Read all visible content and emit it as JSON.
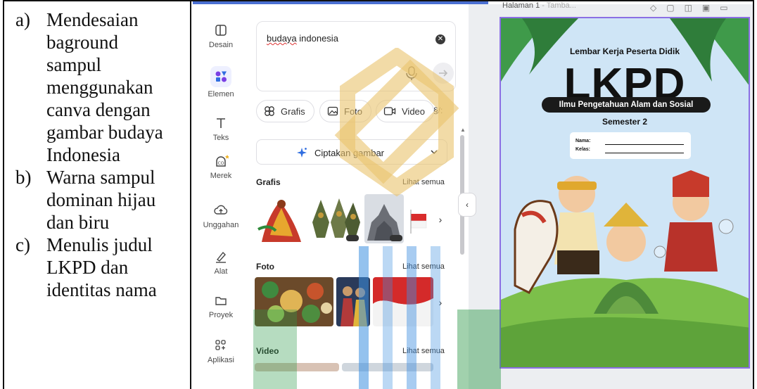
{
  "left_column": {
    "items": [
      {
        "marker": "a)",
        "lines": [
          "Mendesaian",
          "baground",
          "sampul",
          "menggunakan",
          "canva dengan",
          "gambar budaya",
          "Indonesia"
        ]
      },
      {
        "marker": "b)",
        "lines": [
          "Warna sampul",
          "dominan hijau",
          "dan biru"
        ]
      },
      {
        "marker": "c)",
        "lines": [
          "Menulis judul",
          "LKPD dan",
          "identitas nama"
        ]
      }
    ]
  },
  "rail": {
    "items": [
      {
        "label": "Desain",
        "icon": "layout-icon"
      },
      {
        "label": "Elemen",
        "icon": "elements-icon"
      },
      {
        "label": "Teks",
        "icon": "text-icon"
      },
      {
        "label": "Merek",
        "icon": "brand-icon"
      },
      {
        "label": "Unggahan",
        "icon": "upload-cloud-icon"
      },
      {
        "label": "Alat",
        "icon": "pen-tool-icon"
      },
      {
        "label": "Proyek",
        "icon": "folder-icon"
      },
      {
        "label": "Aplikasi",
        "icon": "apps-icon"
      }
    ]
  },
  "panel": {
    "search_value": "budaya indonesia",
    "search_first_word": "budaya",
    "search_rest": " indonesia",
    "chips": [
      "Grafis",
      "Foto",
      "Video",
      "§/:"
    ],
    "create_label": "Ciptakan gambar",
    "sections": [
      {
        "title": "Grafis",
        "link": "Lihat semua"
      },
      {
        "title": "Foto",
        "link": "Lihat semua"
      },
      {
        "title": "Video",
        "link": "Lihat semua"
      }
    ]
  },
  "canvas": {
    "page_label": "Halaman 1",
    "page_label_faint": "- Tamba...",
    "cover": {
      "title_top": "Lembar Kerja Peserta Didik",
      "title_big": "LKPD",
      "subject": "Ilmu Pengetahuan Alam dan Sosial",
      "semester": "Semester 2",
      "name_label": "Nama:",
      "class_label": "Kelas:"
    }
  },
  "colors": {
    "accent": "#8b6fe4",
    "cover_sky": "#cfe5f6",
    "grass": "#7cbf4a",
    "watermark_gold": "#e9c36d",
    "watermark_blue": "#3d8fe0",
    "watermark_green": "#2f9a4a"
  }
}
